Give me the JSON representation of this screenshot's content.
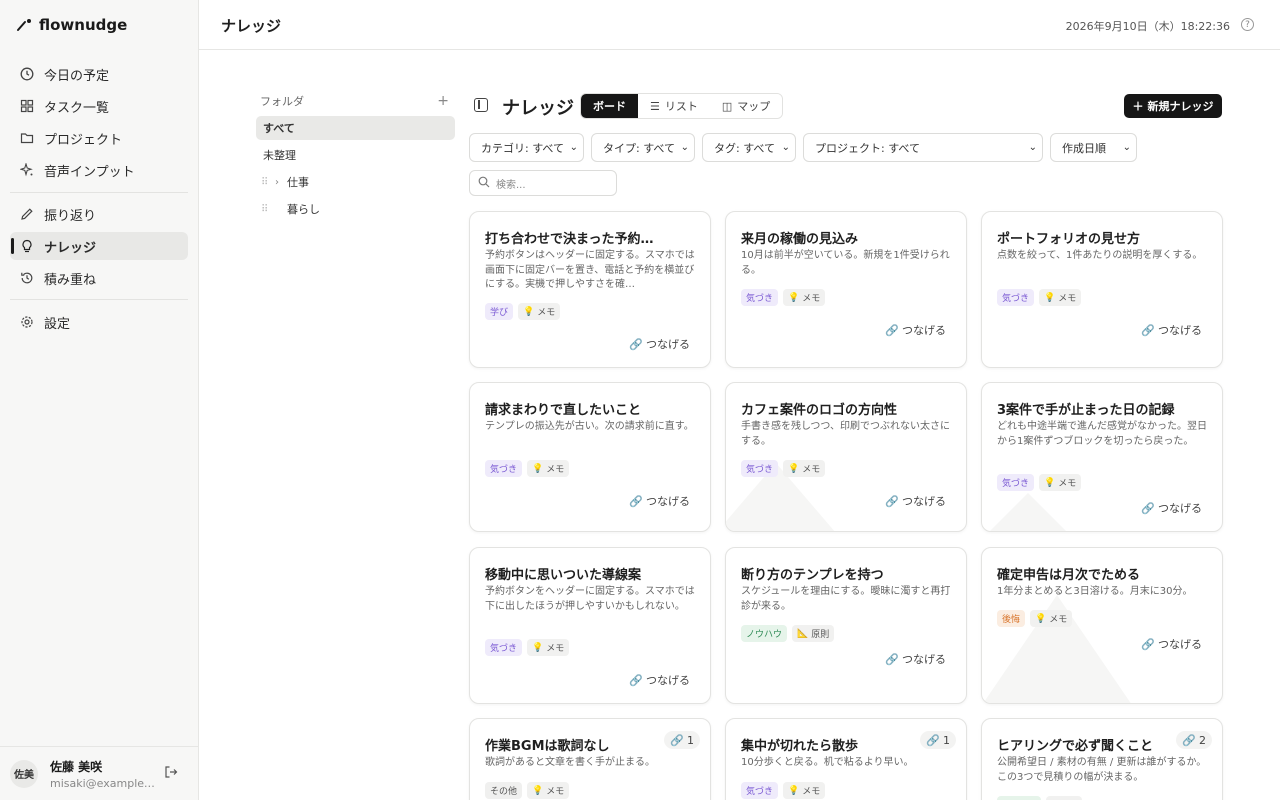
{
  "app": {
    "name": "flownudge"
  },
  "sidebar": {
    "items": [
      {
        "label": "今日の予定",
        "icon": "clock-icon"
      },
      {
        "label": "タスク一覧",
        "icon": "grid-icon"
      },
      {
        "label": "プロジェクト",
        "icon": "folder-icon"
      },
      {
        "label": "音声インプット",
        "icon": "sparkle-icon"
      },
      {
        "label": "振り返り",
        "icon": "pencil-icon"
      },
      {
        "label": "ナレッジ",
        "icon": "lightbulb-icon",
        "active": true
      },
      {
        "label": "積み重ね",
        "icon": "history-icon"
      },
      {
        "label": "設定",
        "icon": "gear-icon"
      }
    ],
    "user": {
      "avatar": "佐美",
      "name": "佐藤 美咲",
      "email": "misaki@example.…"
    }
  },
  "header": {
    "title": "ナレッジ",
    "datetime": "2026年9月10日（木）18:22:36",
    "help": "?"
  },
  "folders": {
    "heading": "フォルダ",
    "add": "+",
    "items": [
      "すべて",
      "未整理",
      "仕事",
      "暮らし"
    ]
  },
  "main": {
    "title": "ナレッジ",
    "views": [
      "ボード",
      "リスト",
      "マップ"
    ],
    "new_button": "新規ナレッジ",
    "filters": [
      "カテゴリ: すべて",
      "タイプ: すべて",
      "タグ: すべて",
      "プロジェクト: すべて",
      "作成日順"
    ],
    "search_placeholder": "検索..."
  },
  "cards": [
    {
      "title": "打ち合わせで決まった予約…",
      "desc": "予約ボタンはヘッダーに固定する。スマホでは画面下に固定バーを置き、電話と予約を横並びにする。実機で押しやすさを確…",
      "cat": "学び",
      "type": "メモ",
      "action": "つなげる"
    },
    {
      "title": "来月の稼働の見込み",
      "desc": "10月は前半が空いている。新規を1件受けられる。",
      "cat": "気づき",
      "type": "メモ",
      "action": "つなげる"
    },
    {
      "title": "ポートフォリオの見せ方",
      "desc": "点数を絞って、1件あたりの説明を厚くする。",
      "cat": "気づき",
      "type": "メモ",
      "action": "つなげる"
    },
    {
      "title": "請求まわりで直したいこと",
      "desc": "テンプレの振込先が古い。次の請求前に直す。",
      "cat": "気づき",
      "type": "メモ",
      "action": "つなげる"
    },
    {
      "title": "カフェ案件のロゴの方向性",
      "desc": "手書き感を残しつつ、印刷でつぶれない太さにする。",
      "cat": "気づき",
      "type": "メモ",
      "action": "つなげる"
    },
    {
      "title": "3案件で手が止まった日の記録",
      "desc": "どれも中途半端で進んだ感覚がなかった。翌日から1案件ずつブロックを切ったら戻った。",
      "cat": "気づき",
      "type": "メモ",
      "action": "つなげる"
    },
    {
      "title": "移動中に思いついた導線案",
      "desc": "予約ボタンをヘッダーに固定する。スマホでは下に出したほうが押しやすいかもしれない。",
      "cat": "気づき",
      "type": "メモ",
      "action": "つなげる"
    },
    {
      "title": "断り方のテンプレを持つ",
      "desc": "スケジュールを理由にする。曖昧に濁すと再打診が来る。",
      "cat": "ノウハウ",
      "type": "原則",
      "action": "つなげる"
    },
    {
      "title": "確定申告は月次でためる",
      "desc": "1年分まとめると3日溶ける。月末に30分。",
      "cat": "後悔",
      "type": "メモ",
      "action": "つなげる"
    },
    {
      "title": "作業BGMは歌詞なし",
      "desc": "歌詞があると文章を書く手が止まる。",
      "cat": "その他",
      "type": "メモ",
      "links": "1"
    },
    {
      "title": "集中が切れたら散歩",
      "desc": "10分歩くと戻る。机で粘るより早い。",
      "cat": "気づき",
      "type": "メモ",
      "links": "1"
    },
    {
      "title": "ヒアリングで必ず聞くこと",
      "desc": "公開希望日 / 素材の有無 / 更新は誰がするか。この3つで見積りの幅が決まる。",
      "cat": "",
      "type": "",
      "links": "2"
    }
  ]
}
